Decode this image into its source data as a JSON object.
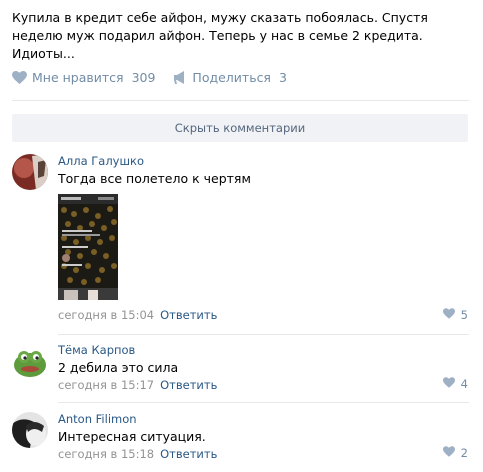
{
  "post": {
    "text": "Купила в кредит себе айфон, мужу сказать побоялась. Спустя неделю муж подарил айфон. Теперь у нас в семье 2 кредита. Идиоты...",
    "like_label": "Мне нравится",
    "like_count": "309",
    "share_label": "Поделиться",
    "share_count": "3"
  },
  "hide_comments_label": "Скрыть комментарии",
  "comments": [
    {
      "author": "Алла Галушко",
      "text": "Тогда все полетело к чертям",
      "date": "сегодня в 15:04",
      "reply": "Ответить",
      "likes": "5"
    },
    {
      "author": "Тёма Карпов",
      "text": "2 дебила это сила",
      "date": "сегодня в 15:17",
      "reply": "Ответить",
      "likes": "4"
    },
    {
      "author": "Anton Filimon",
      "text": "Интересная ситуация.",
      "date": "сегодня в 15:18",
      "reply": "Ответить",
      "likes": "2"
    }
  ],
  "icons": {
    "like": "heart-icon",
    "share": "megaphone-icon"
  },
  "colors": {
    "link": "#2a5885",
    "muted": "#939393",
    "action": "#728ca6",
    "bar": "#f0f2f5"
  }
}
